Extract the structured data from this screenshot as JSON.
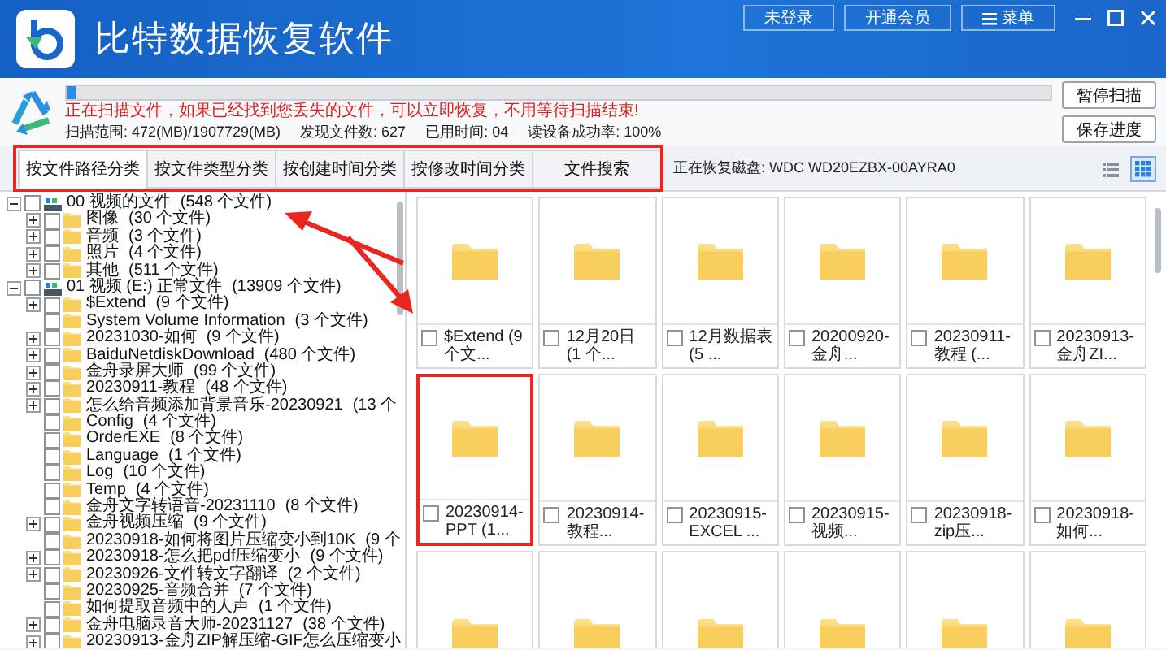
{
  "app": {
    "title": "比特数据恢复软件",
    "buttons": [
      "未登录",
      "开通会员"
    ],
    "menu_button": "菜单"
  },
  "scan": {
    "level": 0.01,
    "message": "正在扫描文件，如果已经找到您丢失的文件，可以立即恢复，不用等待扫描结束!",
    "stats": [
      "扫描范围: 472(MB)/1907729(MB)",
      "发现文件数: 627",
      "已用时间: 04",
      "读设备成功率: 100%"
    ],
    "buttons": [
      "暂停扫描",
      "保存进度"
    ]
  },
  "tab_bar": {
    "highlighted": true,
    "tabs": [
      {
        "label": "按文件路径分类",
        "selected": true
      },
      {
        "label": "按文件类型分类",
        "selected": false
      },
      {
        "label": "按创建时间分类",
        "selected": false
      },
      {
        "label": "按修改时间分类",
        "selected": false
      },
      {
        "label": "文件搜索",
        "selected": false
      }
    ],
    "disk_label": "正在恢复磁盘: WDC WD20EZBX-00AYRA0",
    "view_modes": [
      {
        "kind": "list",
        "selected": false
      },
      {
        "kind": "grid",
        "selected": true
      }
    ]
  },
  "tree": [
    {
      "kind": "drive",
      "name": "00 视频的文件",
      "count": "(548 个文件)",
      "expanded": true,
      "checked": false,
      "children": [
        {
          "kind": "folder",
          "name": "图像",
          "count": "(30 个文件)",
          "expanded": false,
          "checked": false
        },
        {
          "kind": "folder",
          "name": "音频",
          "count": "(3 个文件)",
          "expanded": false,
          "checked": false
        },
        {
          "kind": "folder",
          "name": "照片",
          "count": "(4 个文件)",
          "expanded": false,
          "checked": false
        },
        {
          "kind": "folder",
          "name": "其他",
          "count": "(511 个文件)",
          "expanded": false,
          "checked": false
        }
      ]
    },
    {
      "kind": "drive",
      "name": "01 视频 (E:) 正常文件",
      "count": "(13909 个文件)",
      "expanded": true,
      "checked": false,
      "children": [
        {
          "kind": "folder",
          "name": "$Extend",
          "count": "(9 个文件)",
          "expanded": false,
          "checked": false
        },
        {
          "kind": "folder",
          "name": "System Volume Information",
          "count": "(3 个文件)",
          "checked": false
        },
        {
          "kind": "folder",
          "name": "20231030-如何",
          "count": "(9 个文件)",
          "expanded": false,
          "checked": false
        },
        {
          "kind": "folder",
          "name": "BaiduNetdiskDownload",
          "count": "(480 个文件)",
          "expanded": false,
          "checked": false
        },
        {
          "kind": "folder",
          "name": "金舟录屏大师",
          "count": "(99 个文件)",
          "expanded": false,
          "checked": false
        },
        {
          "kind": "folder",
          "name": "20230911-教程",
          "count": "(48 个文件)",
          "expanded": false,
          "checked": false
        },
        {
          "kind": "folder",
          "name": "怎么给音频添加背景音乐-20230921",
          "count": "(13 个",
          "expanded": false,
          "checked": false
        },
        {
          "kind": "folder",
          "name": "Config",
          "count": "(4 个文件)",
          "checked": false
        },
        {
          "kind": "folder",
          "name": "OrderEXE",
          "count": "(8 个文件)",
          "checked": false
        },
        {
          "kind": "folder",
          "name": "Language",
          "count": "(1 个文件)",
          "checked": false
        },
        {
          "kind": "folder",
          "name": "Log",
          "count": "(10 个文件)",
          "checked": false
        },
        {
          "kind": "folder",
          "name": "Temp",
          "count": "(4 个文件)",
          "checked": false
        },
        {
          "kind": "folder",
          "name": "金舟文字转语音-20231110",
          "count": "(8 个文件)",
          "checked": false
        },
        {
          "kind": "folder",
          "name": "金舟视频压缩",
          "count": "(9 个文件)",
          "expanded": false,
          "checked": false
        },
        {
          "kind": "folder",
          "name": "20230918-如何将图片压缩变小到10K",
          "count": "(9 个",
          "checked": false
        },
        {
          "kind": "folder",
          "name": "20230918-怎么把pdf压缩变小",
          "count": "(9 个文件)",
          "expanded": false,
          "checked": false
        },
        {
          "kind": "folder",
          "name": "20230926-文件转文字翻译",
          "count": "(2 个文件)",
          "expanded": false,
          "checked": false
        },
        {
          "kind": "folder",
          "name": "20230925-音频合并",
          "count": "(7 个文件)",
          "checked": false
        },
        {
          "kind": "folder",
          "name": "如何提取音频中的人声",
          "count": "(1 个文件)",
          "checked": false
        },
        {
          "kind": "folder",
          "name": "金舟电脑录音大师-20231127",
          "count": "(38 个文件)",
          "expanded": false,
          "checked": false
        },
        {
          "kind": "folder",
          "name": "20230913-金舟ZIP解压缩-GIF怎么压缩变小",
          "expanded": false,
          "checked": false
        }
      ]
    }
  ],
  "tiles": [
    {
      "kind": "folder",
      "label": "$Extend (9 个文...",
      "checked": false,
      "highlighted": false
    },
    {
      "kind": "folder",
      "label": "12月20日 (1 个...",
      "checked": false,
      "highlighted": false
    },
    {
      "kind": "folder",
      "label": "12月数据表 (5 ...",
      "checked": false,
      "highlighted": false
    },
    {
      "kind": "folder",
      "label": "20200920-金舟...",
      "checked": false,
      "highlighted": false
    },
    {
      "kind": "folder",
      "label": "20230911-教程 (...",
      "checked": false,
      "highlighted": false
    },
    {
      "kind": "folder",
      "label": "20230913-金舟ZI...",
      "checked": false,
      "highlighted": false
    },
    {
      "kind": "folder",
      "label": "20230914-PPT (1...",
      "checked": false,
      "highlighted": true
    },
    {
      "kind": "folder",
      "label": "20230914-教程...",
      "checked": false,
      "highlighted": false
    },
    {
      "kind": "folder",
      "label": "20230915-EXCEL ...",
      "checked": false,
      "highlighted": false
    },
    {
      "kind": "folder",
      "label": "20230915-视频...",
      "checked": false,
      "highlighted": false
    },
    {
      "kind": "folder",
      "label": "20230918-zip压...",
      "checked": false,
      "highlighted": false
    },
    {
      "kind": "folder",
      "label": "20230918-如何...",
      "checked": false,
      "highlighted": false
    },
    {
      "kind": "folder"
    },
    {
      "kind": "folder"
    },
    {
      "kind": "folder"
    },
    {
      "kind": "folder"
    },
    {
      "kind": "folder"
    },
    {
      "kind": "folder"
    }
  ]
}
